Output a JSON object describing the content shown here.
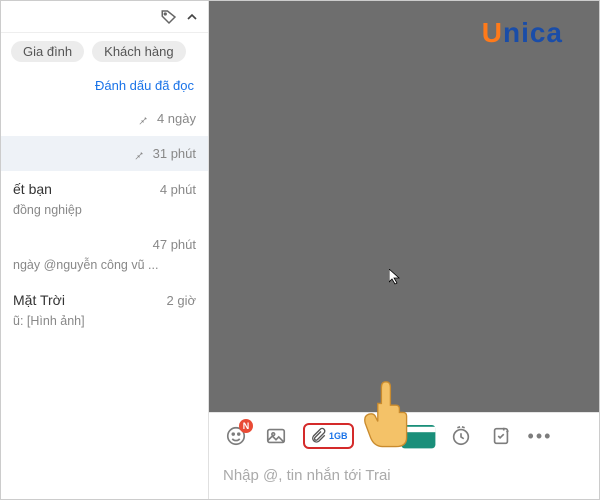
{
  "brand": {
    "u": "U",
    "rest": "nica"
  },
  "tags": {
    "t1": "Gia đình",
    "t2": "Khách hàng"
  },
  "mark_read": "Đánh dấu đã đọc",
  "conversations": [
    {
      "title": "",
      "sub": "",
      "time": "4 ngày",
      "pinned": true
    },
    {
      "title": "",
      "sub": "",
      "time": "31 phút",
      "pinned": true,
      "selected": true
    },
    {
      "title": "ết bạn",
      "sub": "đồng nghiệp",
      "time": "4 phút"
    },
    {
      "title": "",
      "sub": "ngày @nguyễn công vũ ...",
      "time": "47 phút"
    },
    {
      "title": "Mặt Trời",
      "sub": "ũ: [Hình ảnh]",
      "time": "2 giờ"
    }
  ],
  "attach": {
    "label": "1GB"
  },
  "sticker_badge": "N",
  "input": {
    "placeholder": "Nhập @, tin nhắn tới Trai"
  }
}
